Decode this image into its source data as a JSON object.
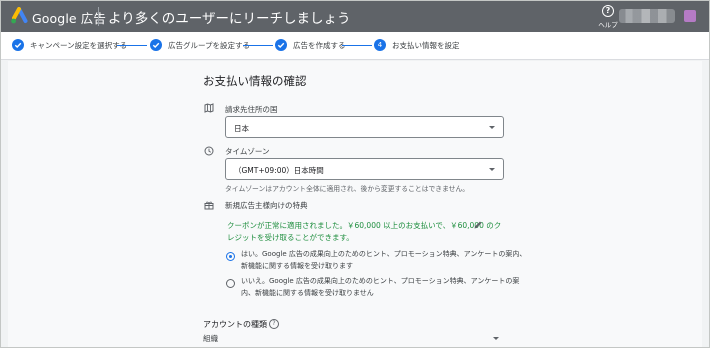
{
  "header": {
    "brand": "Google 広告",
    "page_title": "より多くのユーザーにリーチしましょう",
    "help_label": "ヘルプ"
  },
  "stepper": {
    "steps": [
      {
        "label": "キャンペーン設定を選択する",
        "state": "done"
      },
      {
        "label": "広告グループを設定する",
        "state": "done"
      },
      {
        "label": "広告を作成する",
        "state": "done"
      },
      {
        "label": "お支払い情報を設定",
        "state": "current",
        "number": "4"
      }
    ]
  },
  "main": {
    "heading": "お支払い情報の確認",
    "billing_country": {
      "label": "請求先住所の国",
      "value": "日本",
      "icon": "map-icon"
    },
    "timezone": {
      "label": "タイムゾーン",
      "value": "（GMT+09:00）日本時間",
      "hint": "タイムゾーンはアカウント全体に適用され、後から変更することはできません。",
      "icon": "clock-icon"
    },
    "promo": {
      "label": "新規広告主様向けの特典",
      "icon": "gift-icon",
      "lines": [
        "クーポンが正常に適用されました。￥60,000 以上のお支払いで、￥60,000 のク",
        "レジットを受け取ることができます。"
      ]
    },
    "emails": {
      "selected": 0,
      "options": [
        {
          "lines": [
            "はい。Google 広告の成果向上のためのヒント、プロモーション特典、アンケートの案内、",
            "新機能に関する情報を受け取ります"
          ]
        },
        {
          "lines": [
            "いいえ。Google 広告の成果向上のためのヒント、プロモーション特典、アンケートの案",
            "内、新機能に関する情報を受け取りません"
          ]
        }
      ]
    },
    "account_type": {
      "label": "アカウントの種類",
      "value": "組織"
    }
  },
  "colors": {
    "accent": "#1a73e8",
    "topbar": "#5f6368",
    "promo_text": "#1e8e3e"
  }
}
